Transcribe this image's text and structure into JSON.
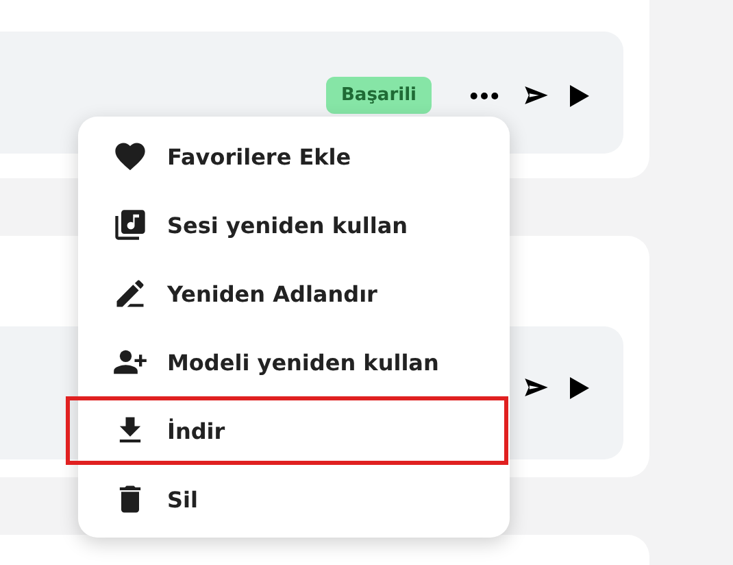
{
  "rows": [
    {
      "status": "Başarili"
    },
    {
      "status": null
    }
  ],
  "context_menu": {
    "items": [
      {
        "kind": "heart",
        "label": "Favorilere Ekle",
        "highlighted": false
      },
      {
        "kind": "library-music",
        "label": "Sesi yeniden kullan",
        "highlighted": false
      },
      {
        "kind": "pencil",
        "label": "Yeniden Adlandır",
        "highlighted": false
      },
      {
        "kind": "person-add",
        "label": "Modeli yeniden kullan",
        "highlighted": false
      },
      {
        "kind": "download",
        "label": "İndir",
        "highlighted": true
      },
      {
        "kind": "trash",
        "label": "Sil",
        "highlighted": false
      }
    ]
  }
}
